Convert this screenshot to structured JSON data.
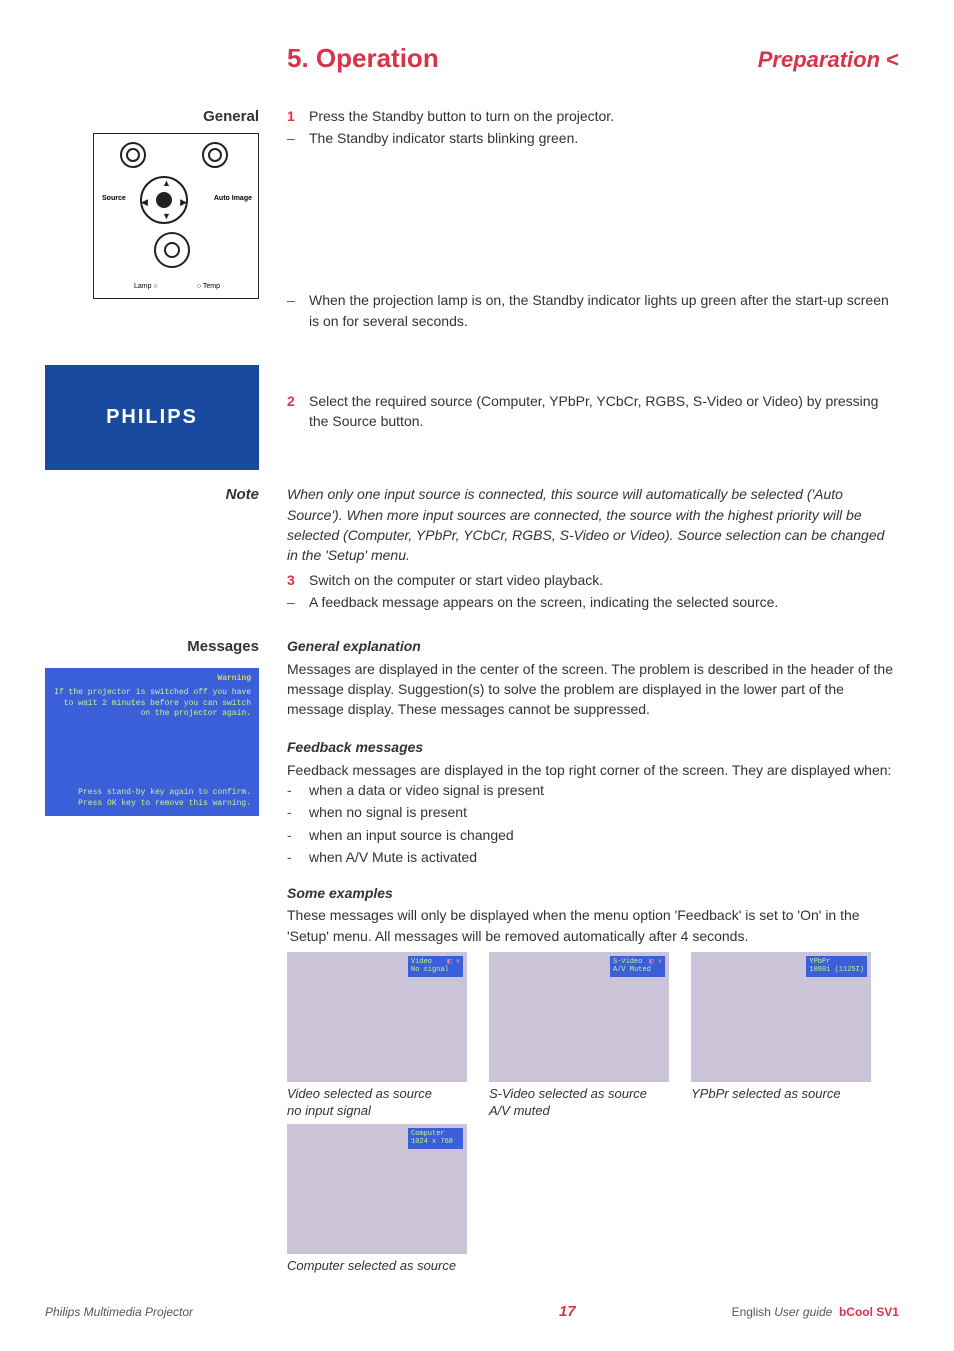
{
  "header": {
    "title": "5. Operation",
    "subtitle": "Preparation",
    "chevron": "<"
  },
  "labels": {
    "general": "General",
    "note": "Note",
    "messages": "Messages"
  },
  "panel": {
    "source": "Source",
    "autoimage": "Auto Image",
    "lamp": "Lamp",
    "temp": "Temp"
  },
  "splash": {
    "brand": "PHILIPS"
  },
  "steps": {
    "s1": "1",
    "s1text": "Press the Standby button to turn on the projector.",
    "s1sub": "The Standby indicator starts blinking green.",
    "lampnote": "When the projection lamp is on, the Standby indicator lights up green after the start-up screen is on for several seconds.",
    "s2": "2",
    "s2text": "Select the required source (Computer, YPbPr, YCbCr, RGBS, S-Video or Video) by pressing the Source button.",
    "notebody": "When only one input source is connected, this source will automatically be selected ('Auto Source'). When more input sources are connected, the source with the highest priority will be selected (Computer, YPbPr, YCbCr, RGBS, S-Video or Video). Source selection can be changed in the 'Setup' menu.",
    "s3": "3",
    "s3text": "Switch on the computer or start video playback.",
    "s3sub": "A feedback message appears on the screen, indicating the selected source."
  },
  "general_exp": {
    "head": "General explanation",
    "body": "Messages are displayed in the center of the screen. The problem is described in the header of the message display. Suggestion(s) to solve the problem are displayed in the lower part of the message display. These messages cannot be suppressed."
  },
  "feedback": {
    "head": "Feedback messages",
    "intro": "Feedback messages are displayed in the top right corner of the screen. They are displayed when:",
    "b1": "when a data or video signal is present",
    "b2": "when no signal is present",
    "b3": "when an input source is changed",
    "b4": "when A/V Mute is activated"
  },
  "examples": {
    "head": "Some examples",
    "intro": "These messages will only be displayed when the menu option 'Feedback' is set to 'On' in the 'Setup' menu. All messages will be removed automatically after 4 seconds.",
    "a": {
      "tag1": "Video",
      "redicon": "◧ ✕",
      "tag2": "No signal",
      "cap1": "Video selected as source",
      "cap2": "no input signal"
    },
    "b": {
      "tag1": "S-Video",
      "redicon": "◧ ✕",
      "tag2": "A/V Muted",
      "cap1": "S-Video selected as source",
      "cap2": "A/V muted"
    },
    "c": {
      "tag1": "YPbPr",
      "tag2": "1080i (1125I)",
      "cap1": "YPbPr selected as source"
    },
    "d": {
      "tag1": "Computer",
      "tag2": "1024 x 768",
      "cap1": "Computer selected as source"
    }
  },
  "warning": {
    "title": "Warning",
    "line1": "If the projector is switched off you have to wait 2 minutes before you can switch on the projector again.",
    "line2": "Press stand-by key again to confirm.",
    "line3": "Press OK key to remove this warning."
  },
  "footer": {
    "left": "Philips Multimedia Projector",
    "page": "17",
    "lang": "English",
    "guide": "User guide",
    "model": "bCool SV1"
  }
}
